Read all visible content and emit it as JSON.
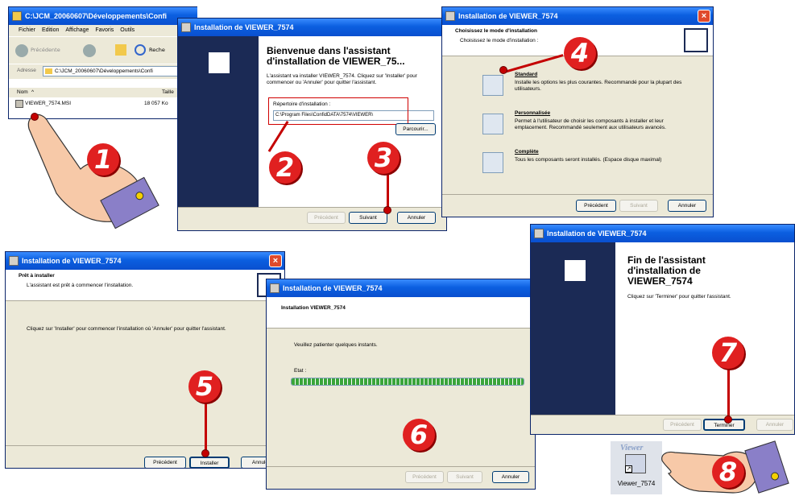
{
  "explorer": {
    "path": "C:\\JCM_20060607\\Développements\\Confi",
    "menu": [
      "Fichier",
      "Edition",
      "Affichage",
      "Favoris",
      "Outils"
    ],
    "back_label": "Précédente",
    "search_label": "Reche",
    "address_label": "Adresse",
    "address_value": "C:\\JCM_20060607\\Développements\\Confi",
    "col_name": "Nom",
    "col_size": "Taille",
    "file_name": "VIEWER_7574.MSI",
    "file_size": "18 057 Ko"
  },
  "step2": {
    "title": "Installation de VIEWER_7574",
    "heading": "Bienvenue dans l'assistant d'installation de VIEWER_75...",
    "desc": "L'assistant va installer VIEWER_7574. Cliquez sur 'Installer' pour commencer ou 'Annuler' pour quitter l'assistant.",
    "dir_label": "Répertoire d'installation :",
    "dir_value": "C:\\Program Files\\ConfidDATA\\7574\\VIEWER\\",
    "browse": "Parcourir...",
    "prev": "Précédent",
    "next": "Suivant",
    "cancel": "Annuler"
  },
  "step4": {
    "title": "Installation de VIEWER_7574",
    "heading": "Choisissez le mode d'installation",
    "sub": "Choisissez le mode d'installation :",
    "options": [
      {
        "name": "Standard",
        "desc": "Installe les options les plus courantes. Recommandé pour la plupart des utilisateurs."
      },
      {
        "name": "Personnalisée",
        "desc": "Permet à l'utilisateur de choisir les composants à installer et leur emplacement. Recommandé seulement aux utilisateurs avancés."
      },
      {
        "name": "Complète",
        "desc": "Tous les composants seront installés. (Espace disque maximal)"
      }
    ],
    "prev": "Précédent",
    "next": "Suivant",
    "cancel": "Annuler"
  },
  "step5": {
    "title": "Installation de VIEWER_7574",
    "heading": "Prêt à installer",
    "sub": "L'assistant est prêt à commencer l'installation.",
    "body": "Cliquez sur 'Installer' pour commencer l'installation où 'Annuler' pour quitter l'assistant.",
    "prev": "Précédent",
    "install": "Installer",
    "cancel": "Annule"
  },
  "step6": {
    "title": "Installation de VIEWER_7574",
    "heading": "Installation VIEWER_7574",
    "wait": "Veuillez patienter quelques instants.",
    "state_label": "Etat :",
    "progress": 1.0,
    "prev": "Précédent",
    "next": "Suivant",
    "cancel": "Annuler"
  },
  "step7": {
    "title": "Installation de VIEWER_7574",
    "heading": "Fin de l'assistant d'installation de VIEWER_7574",
    "desc": "Cliquez sur 'Terminer' pour quitter l'assistant.",
    "prev": "Précédent",
    "finish": "Terminer",
    "cancel": "Annuler"
  },
  "shortcut": {
    "logo_text": "Viewer",
    "label": "Viewer_7574"
  },
  "steps": [
    "1",
    "2",
    "3",
    "4",
    "5",
    "6",
    "7",
    "8"
  ],
  "colors": {
    "titlebar": "#0b5fe0",
    "badge": "#e02020",
    "wizard_panel": "#1b2a55",
    "progress": "#3aa53a",
    "window_bg": "#ece9d8"
  }
}
